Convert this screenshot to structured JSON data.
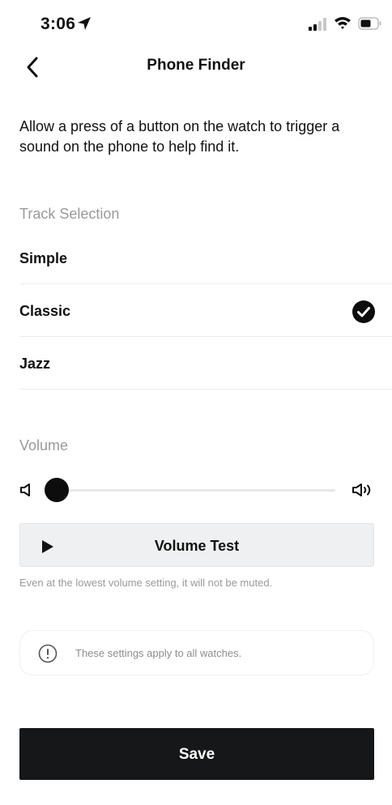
{
  "status_bar": {
    "time": "3:06",
    "icons": [
      "location-arrow-icon",
      "signal-icon",
      "wifi-icon",
      "battery-icon"
    ]
  },
  "header": {
    "title": "Phone Finder",
    "back_icon": "chevron-left-icon"
  },
  "description": "Allow a press of a button on the watch to trigger a sound on the phone to help find it.",
  "track_selection": {
    "label": "Track Selection",
    "items": [
      {
        "label": "Simple",
        "selected": false
      },
      {
        "label": "Classic",
        "selected": true
      },
      {
        "label": "Jazz",
        "selected": false
      }
    ]
  },
  "volume": {
    "label": "Volume",
    "level": 0.0,
    "test_button_label": "Volume Test",
    "hint": "Even at the lowest volume setting, it will not be muted."
  },
  "notice": {
    "text": "These settings apply to all watches.",
    "icon": "info-icon"
  },
  "save_label": "Save",
  "colors": {
    "primary": "#161718",
    "muted_text": "#9a9a9a",
    "panel_bg": "#eef0f1"
  }
}
